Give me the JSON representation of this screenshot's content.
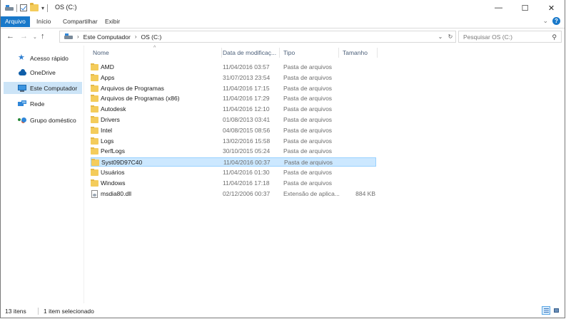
{
  "window": {
    "title": "OS (C:)",
    "controls": {
      "minimize": "—",
      "maximize": "☐",
      "close": "✕"
    }
  },
  "ribbon": {
    "tabs": [
      "Arquivo",
      "Início",
      "Compartilhar",
      "Exibir"
    ],
    "expand_chevron": "⌄",
    "help": "?"
  },
  "nav": {
    "back": "←",
    "forward": "→",
    "recent": "⌄",
    "up": "↑"
  },
  "address": {
    "crumbs": [
      "Este Computador",
      "OS (C:)"
    ],
    "separator": "›",
    "dropdown": "⌄",
    "refresh": "↻"
  },
  "search": {
    "placeholder": "Pesquisar OS (C:)",
    "value": ""
  },
  "navpane": {
    "items": [
      {
        "label": "Acesso rápido",
        "icon": "quick-access-star-icon"
      },
      {
        "label": "OneDrive",
        "icon": "onedrive-cloud-icon"
      },
      {
        "label": "Este Computador",
        "icon": "this-pc-icon",
        "selected": true
      },
      {
        "label": "Rede",
        "icon": "network-icon"
      },
      {
        "label": "Grupo doméstico",
        "icon": "homegroup-icon"
      }
    ]
  },
  "columns": {
    "name": "Nome",
    "date": "Data de modificaç...",
    "type": "Tipo",
    "size": "Tamanho",
    "sort_indicator": "^"
  },
  "files": [
    {
      "name": "AMD",
      "date": "11/04/2016 03:57",
      "type": "Pasta de arquivos",
      "size": "",
      "kind": "folder"
    },
    {
      "name": "Apps",
      "date": "31/07/2013 23:54",
      "type": "Pasta de arquivos",
      "size": "",
      "kind": "folder"
    },
    {
      "name": "Arquivos de Programas",
      "date": "11/04/2016 17:15",
      "type": "Pasta de arquivos",
      "size": "",
      "kind": "folder"
    },
    {
      "name": "Arquivos de Programas (x86)",
      "date": "11/04/2016 17:29",
      "type": "Pasta de arquivos",
      "size": "",
      "kind": "folder"
    },
    {
      "name": "Autodesk",
      "date": "11/04/2016 12:10",
      "type": "Pasta de arquivos",
      "size": "",
      "kind": "folder"
    },
    {
      "name": "Drivers",
      "date": "01/08/2013 03:41",
      "type": "Pasta de arquivos",
      "size": "",
      "kind": "folder"
    },
    {
      "name": "Intel",
      "date": "04/08/2015 08:56",
      "type": "Pasta de arquivos",
      "size": "",
      "kind": "folder"
    },
    {
      "name": "Logs",
      "date": "13/02/2016 15:58",
      "type": "Pasta de arquivos",
      "size": "",
      "kind": "folder"
    },
    {
      "name": "PerfLogs",
      "date": "30/10/2015 05:24",
      "type": "Pasta de arquivos",
      "size": "",
      "kind": "folder"
    },
    {
      "name": "Syst09D97C40",
      "date": "11/04/2016 00:37",
      "type": "Pasta de arquivos",
      "size": "",
      "kind": "folder",
      "selected": true
    },
    {
      "name": "Usuários",
      "date": "11/04/2016 01:30",
      "type": "Pasta de arquivos",
      "size": "",
      "kind": "folder"
    },
    {
      "name": "Windows",
      "date": "11/04/2016 17:18",
      "type": "Pasta de arquivos",
      "size": "",
      "kind": "folder"
    },
    {
      "name": "msdia80.dll",
      "date": "02/12/2006 00:37",
      "type": "Extensão de aplica...",
      "size": "884 KB",
      "kind": "dll"
    }
  ],
  "status": {
    "count": "13 itens",
    "selected": "1 item selecionado"
  },
  "colors": {
    "accent": "#1979ca",
    "selection": "#cce8ff",
    "selection_border": "#99d1ff",
    "nav_selected": "#cce4f7",
    "folder": "#f4cc5b"
  }
}
